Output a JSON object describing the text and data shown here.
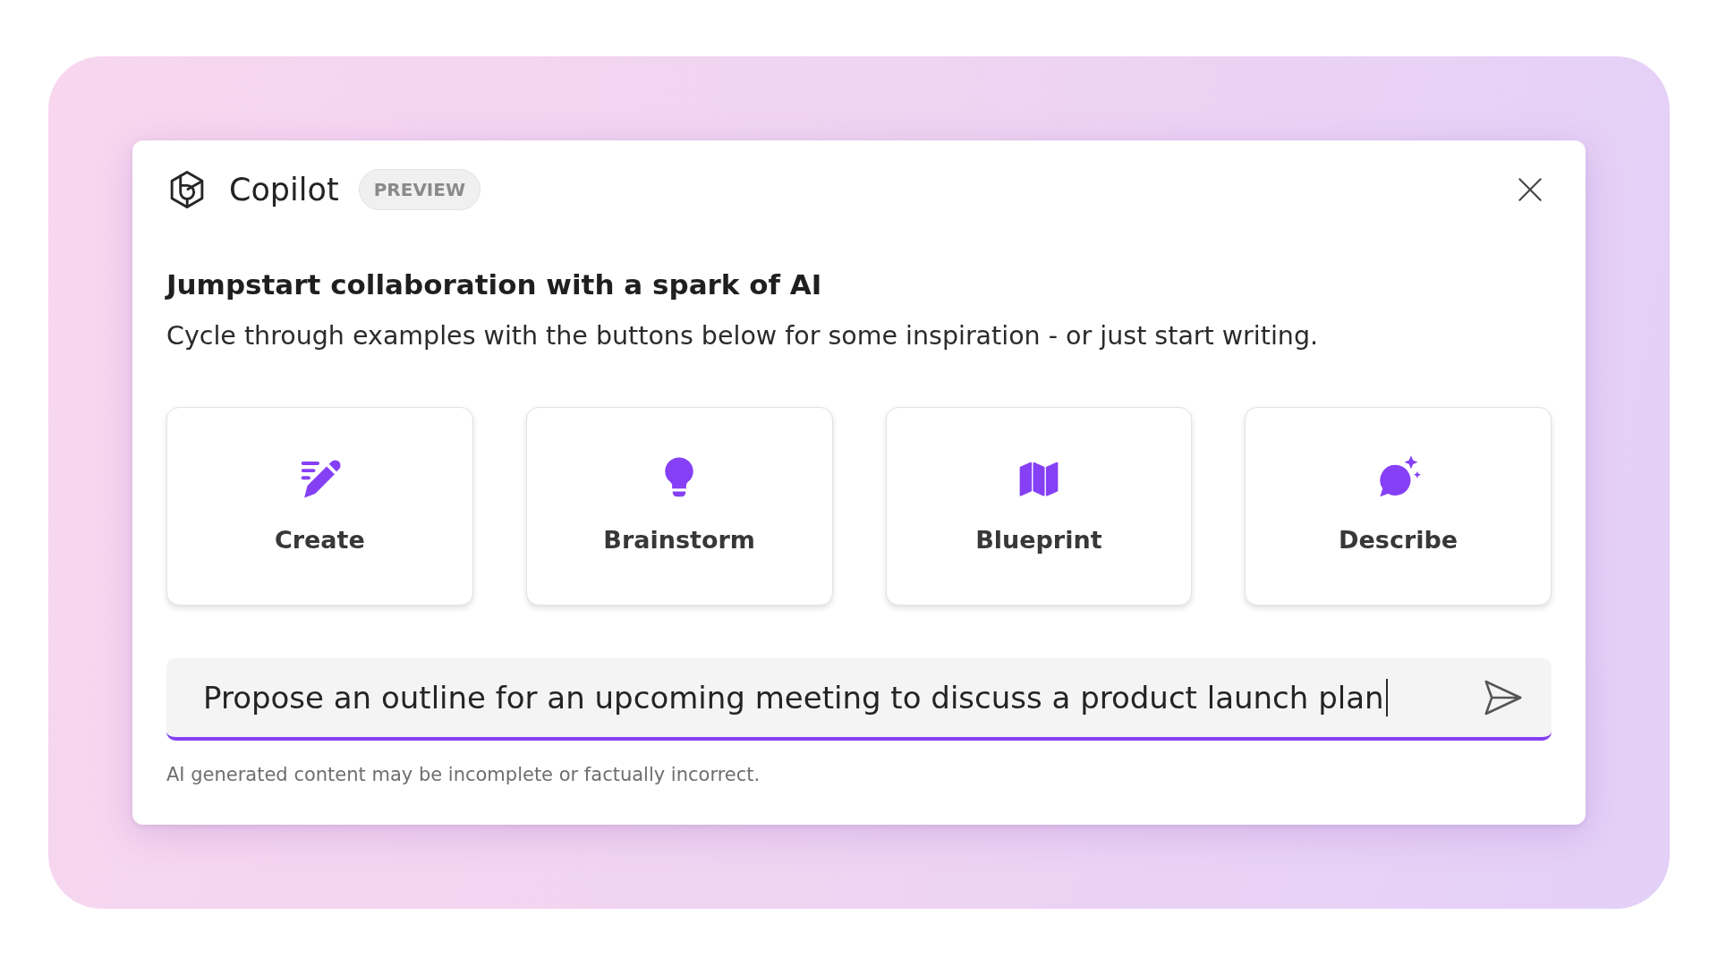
{
  "header": {
    "title": "Copilot",
    "badge": "PREVIEW"
  },
  "heading": "Jumpstart collaboration with a spark of AI",
  "description": "Cycle through examples with the buttons below for some inspiration - or just start writing.",
  "prompt_cards": [
    {
      "kind": "create",
      "label": "Create"
    },
    {
      "kind": "brainstorm",
      "label": "Brainstorm"
    },
    {
      "kind": "blueprint",
      "label": "Blueprint"
    },
    {
      "kind": "describe",
      "label": "Describe"
    }
  ],
  "input": {
    "value": "Propose an outline for an upcoming meeting to discuss a product launch plan",
    "focused": true
  },
  "disclaimer": "AI generated content may be incomplete or factually incorrect."
}
